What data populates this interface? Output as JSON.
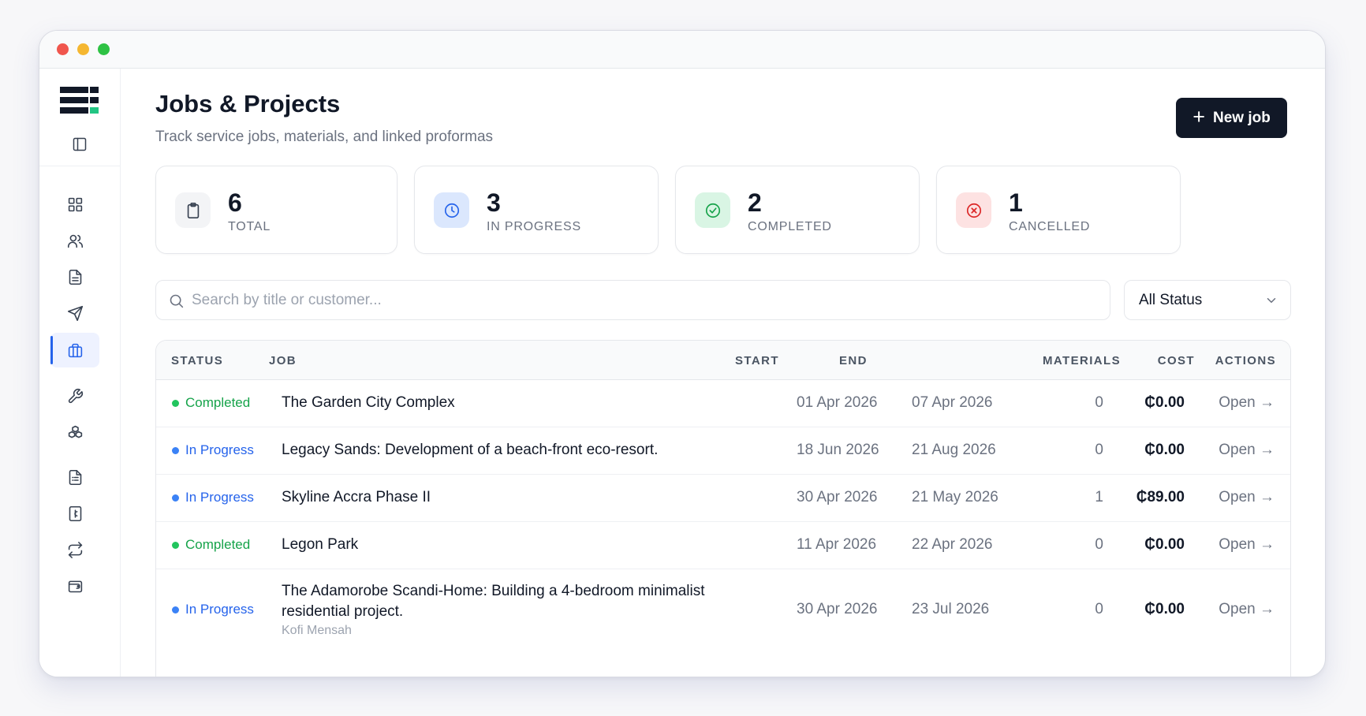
{
  "header": {
    "title": "Jobs & Projects",
    "subtitle": "Track service jobs, materials, and linked proformas",
    "new_button": "New job"
  },
  "sidebar": {
    "items": [
      {
        "icon": "grid-icon",
        "active": false
      },
      {
        "icon": "users-icon",
        "active": false
      },
      {
        "icon": "document-icon",
        "active": false
      },
      {
        "icon": "send-icon",
        "active": false
      },
      {
        "icon": "briefcase-icon",
        "active": true
      },
      {
        "icon": "wrench-icon",
        "active": false
      },
      {
        "icon": "boxes-icon",
        "active": false
      },
      {
        "icon": "receipt-icon",
        "active": false
      },
      {
        "icon": "cedi-icon",
        "active": false
      },
      {
        "icon": "transfer-icon",
        "active": false
      },
      {
        "icon": "wallet-icon",
        "active": false
      }
    ]
  },
  "stats": [
    {
      "value": "6",
      "label": "TOTAL",
      "icon": "clipboard-icon",
      "color": "#374151",
      "bg": "#f3f4f6"
    },
    {
      "value": "3",
      "label": "IN PROGRESS",
      "icon": "clock-icon",
      "color": "#2563eb",
      "bg": "#dbe7fd"
    },
    {
      "value": "2",
      "label": "COMPLETED",
      "icon": "check-circle-icon",
      "color": "#16a34a",
      "bg": "#d9f5e4"
    },
    {
      "value": "1",
      "label": "CANCELLED",
      "icon": "x-circle-icon",
      "color": "#dc2626",
      "bg": "#fde2e2"
    }
  ],
  "search": {
    "placeholder": "Search by title or customer..."
  },
  "filter": {
    "selected": "All Status"
  },
  "table": {
    "columns": [
      "STATUS",
      "JOB",
      "START",
      "END",
      "MATERIALS",
      "COST",
      "ACTIONS"
    ],
    "rows": [
      {
        "status": "Completed",
        "title": "The Garden City Complex",
        "customer": "",
        "start": "01 Apr 2026",
        "end": "07 Apr 2026",
        "materials": "0",
        "cost": "₵0.00",
        "action": "Open →"
      },
      {
        "status": "In Progress",
        "title": "Legacy Sands: Development of a beach-front eco-resort.",
        "customer": "",
        "start": "18 Jun 2026",
        "end": "21 Aug 2026",
        "materials": "0",
        "cost": "₵0.00",
        "action": "Open →"
      },
      {
        "status": "In Progress",
        "title": "Skyline Accra Phase II",
        "customer": "",
        "start": "30 Apr 2026",
        "end": "21 May 2026",
        "materials": "1",
        "cost": "₵89.00",
        "action": "Open →"
      },
      {
        "status": "Completed",
        "title": "Legon Park",
        "customer": "",
        "start": "11 Apr 2026",
        "end": "22 Apr 2026",
        "materials": "0",
        "cost": "₵0.00",
        "action": "Open →"
      },
      {
        "status": "In Progress",
        "title": "The Adamorobe Scandi-Home: Building a 4-bedroom minimalist residential project.",
        "customer": "Kofi Mensah",
        "start": "30 Apr 2026",
        "end": "23 Jul 2026",
        "materials": "0",
        "cost": "₵0.00",
        "action": "Open →"
      }
    ]
  },
  "colors": {
    "completed": "#16a34a",
    "in_progress": "#2563eb",
    "primary": "#111827"
  }
}
